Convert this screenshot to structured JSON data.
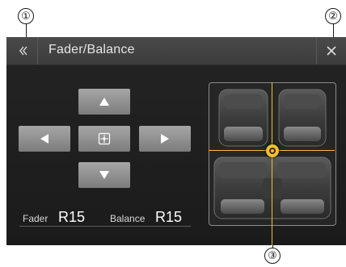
{
  "callouts": [
    "①",
    "②",
    "③"
  ],
  "header": {
    "back_icon": "double-chevron-left-icon",
    "title": "Fader/Balance",
    "close_icon": "close-icon"
  },
  "controls": {
    "up_icon": "arrow-up-icon",
    "down_icon": "arrow-down-icon",
    "left_icon": "arrow-left-icon",
    "right_icon": "arrow-right-icon",
    "center_icon": "center-crosshair-icon"
  },
  "readout": {
    "fader_label": "Fader",
    "fader_value": "R15",
    "balance_label": "Balance",
    "balance_value": "R15"
  },
  "colors": {
    "accent": "#f2c12e",
    "screen_bg": "#1e1e1e",
    "header_bg": "#444444",
    "button": "#8f8f8f"
  }
}
